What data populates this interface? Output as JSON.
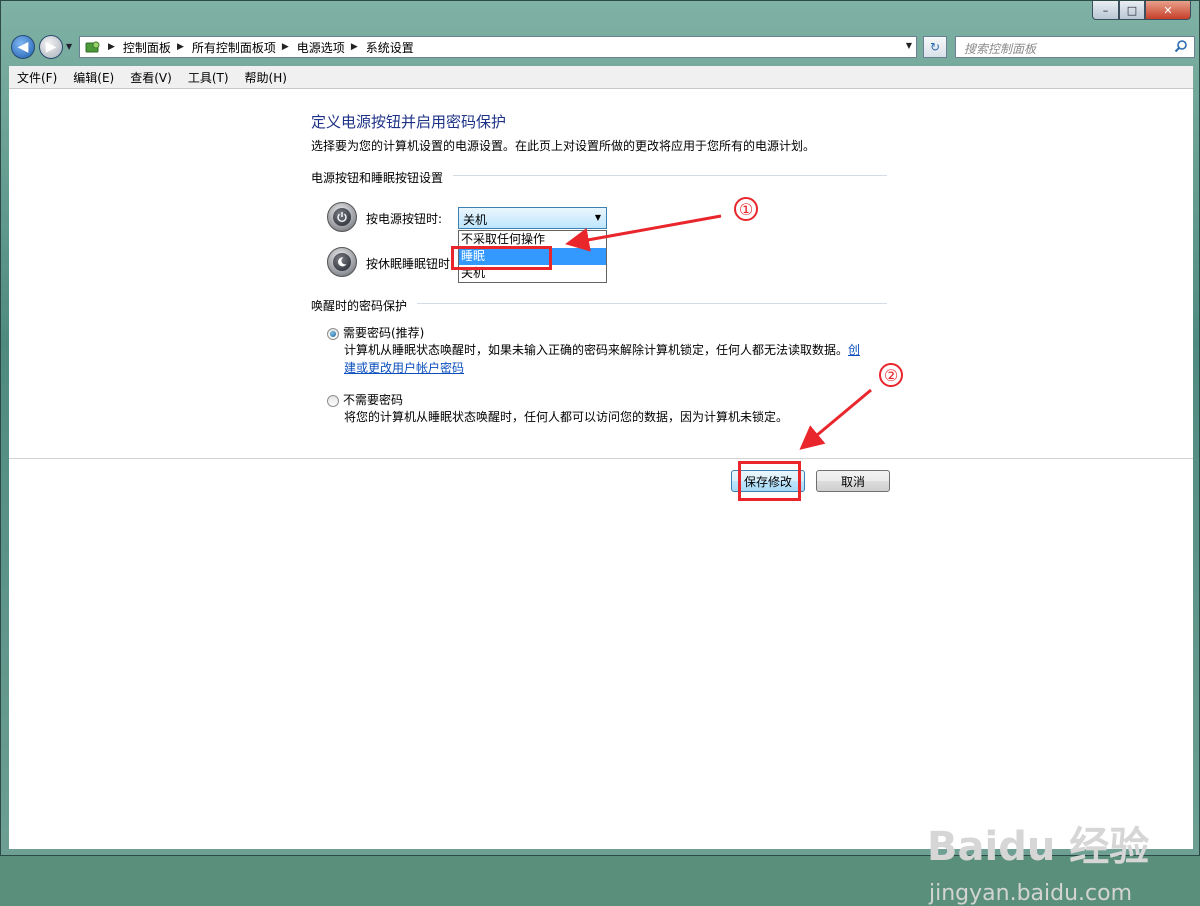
{
  "window": {
    "min_symbol": "–",
    "max_symbol": "□",
    "close_symbol": "✕"
  },
  "nav": {
    "breadcrumbs": [
      "控制面板",
      "所有控制面板项",
      "电源选项",
      "系统设置"
    ],
    "search_placeholder": "搜索控制面板"
  },
  "menu": [
    "文件(F)",
    "编辑(E)",
    "查看(V)",
    "工具(T)",
    "帮助(H)"
  ],
  "page": {
    "title": "定义电源按钮并启用密码保护",
    "description": "选择要为您的计算机设置的电源设置。在此页上对设置所做的更改将应用于您所有的电源计划。",
    "buttons_group": {
      "label": "电源按钮和睡眠按钮设置",
      "power_label": "按电源按钮时:",
      "sleep_label": "按休眠睡眠钮时:",
      "power_value": "关机",
      "options": [
        "不采取任何操作",
        "睡眠",
        "关机"
      ],
      "selected_option": "睡眠"
    },
    "password_group": {
      "label": "唤醒时的密码保护",
      "require": {
        "title": "需要密码(推荐)",
        "desc": "计算机从睡眠状态唤醒时，如果未输入正确的密码来解除计算机锁定，任何人都无法读取数据。",
        "link_part1": "创",
        "link_part2": "建或更改用户帐户密码",
        "checked": true
      },
      "no_require": {
        "title": "不需要密码",
        "desc": "将您的计算机从睡眠状态唤醒时，任何人都可以访问您的数据，因为计算机未锁定。",
        "checked": false
      }
    },
    "save_label": "保存修改",
    "cancel_label": "取消"
  },
  "annotations": {
    "step1": "①",
    "step2": "②"
  },
  "watermark": {
    "brand": "Baidu 经验",
    "url": "jingyan.baidu.com"
  },
  "colors": {
    "title_blue": "#1e3287",
    "annotation_red": "#e8262b",
    "selection_blue": "#3399ff"
  }
}
